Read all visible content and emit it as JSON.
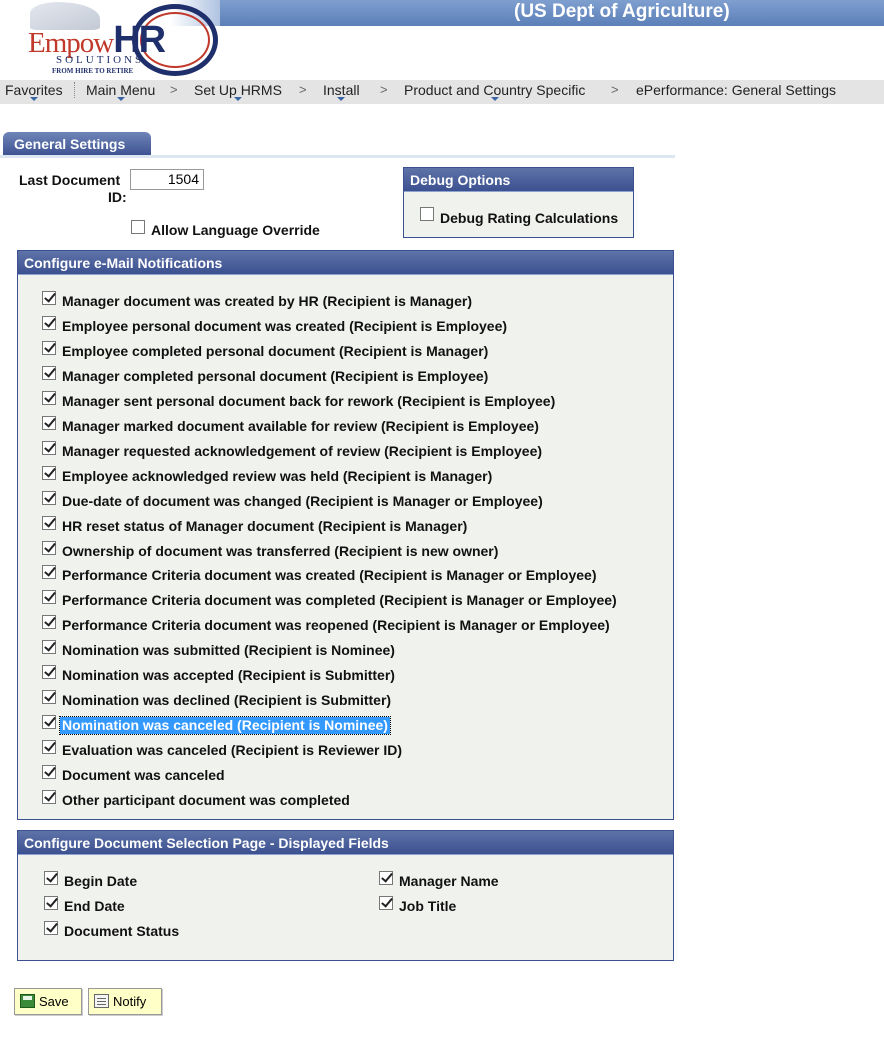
{
  "header": {
    "org_title": "(US Dept of Agriculture)",
    "logo": {
      "main": "Empow",
      "accent": "HR",
      "sub": "SOLUTIONS",
      "tagline": "FROM HIRE TO RETIRE"
    }
  },
  "nav": {
    "items": [
      {
        "label": "Favorites",
        "dropdown": true
      },
      {
        "label": "Main Menu",
        "dropdown": true
      },
      {
        "label": "Set Up HRMS",
        "dropdown": true
      },
      {
        "label": "Install",
        "dropdown": true
      },
      {
        "label": "Product and Country Specific",
        "dropdown": true
      },
      {
        "label": "ePerformance: General Settings",
        "dropdown": false
      }
    ],
    "separator": ">"
  },
  "tab": {
    "label": "General Settings"
  },
  "form": {
    "last_doc_label_1": "Last Document",
    "last_doc_label_2": "ID:",
    "last_doc_value": "1504",
    "allow_lang_override": {
      "label": "Allow Language Override",
      "checked": false
    }
  },
  "debug": {
    "title": "Debug Options",
    "debug_rating": {
      "label": "Debug Rating Calculations",
      "checked": false
    }
  },
  "email": {
    "title": "Configure e-Mail Notifications",
    "items": [
      {
        "label": "Manager document was created by HR (Recipient is Manager)",
        "checked": true
      },
      {
        "label": "Employee personal document was created (Recipient is Employee)",
        "checked": true
      },
      {
        "label": "Employee completed personal document (Recipient is Manager)",
        "checked": true
      },
      {
        "label": "Manager completed personal document (Recipient is Employee)",
        "checked": true
      },
      {
        "label": "Manager sent personal document back for rework (Recipient is Employee)",
        "checked": true
      },
      {
        "label": "Manager marked document available for review (Recipient is Employee)",
        "checked": true
      },
      {
        "label": "Manager requested acknowledgement of review (Recipient is Employee)",
        "checked": true
      },
      {
        "label": "Employee acknowledged review was held (Recipient is Manager)",
        "checked": true
      },
      {
        "label": "Due-date of document was changed (Recipient is Manager or Employee)",
        "checked": true
      },
      {
        "label": "HR reset status of Manager document (Recipient is Manager)",
        "checked": true
      },
      {
        "label": "Ownership of document was transferred (Recipient is new owner)",
        "checked": true
      },
      {
        "label": "Performance Criteria document was created (Recipient is Manager or Employee)",
        "checked": true
      },
      {
        "label": "Performance Criteria document was completed (Recipient is Manager or Employee)",
        "checked": true
      },
      {
        "label": "Performance Criteria document was reopened (Recipient is Manager or Employee)",
        "checked": true
      },
      {
        "label": "Nomination was submitted (Recipient is Nominee)",
        "checked": true
      },
      {
        "label": "Nomination was accepted (Recipient is Submitter)",
        "checked": true
      },
      {
        "label": "Nomination was declined (Recipient is Submitter)",
        "checked": true
      },
      {
        "label": "Nomination was canceled (Recipient is Nominee)",
        "checked": true,
        "selected": true
      },
      {
        "label": "Evaluation was canceled (Recipient is Reviewer ID)",
        "checked": true
      },
      {
        "label": "Document was canceled",
        "checked": true
      },
      {
        "label": "Other participant document was completed",
        "checked": true
      }
    ]
  },
  "docsel": {
    "title": "Configure Document Selection Page - Displayed Fields",
    "left": [
      {
        "label": "Begin Date",
        "checked": true
      },
      {
        "label": "End Date",
        "checked": true
      },
      {
        "label": "Document Status",
        "checked": true
      }
    ],
    "right": [
      {
        "label": "Manager Name",
        "checked": true
      },
      {
        "label": "Job Title",
        "checked": true
      }
    ]
  },
  "buttons": {
    "save": "Save",
    "notify": "Notify"
  },
  "colors": {
    "header_band": "#5b7fb8",
    "group_header": "#3c5190",
    "group_bg": "#f0f2ee",
    "button_bg": "#ffffc8",
    "selection": "#3399ff"
  },
  "icons": {
    "save": "save-icon",
    "notify": "notify-icon",
    "nav_dropdown": "dropdown-triangle-icon"
  }
}
